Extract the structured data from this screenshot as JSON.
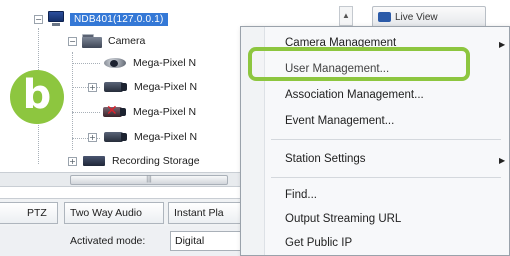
{
  "tree": {
    "server_label": "NDB401(127.0.0.1)",
    "camera_folder": "Camera",
    "cameras": [
      {
        "label": "Mega-Pixel N",
        "icon": "dome-camera-icon"
      },
      {
        "label": "Mega-Pixel N",
        "icon": "box-camera-icon"
      },
      {
        "label": "Mega-Pixel N",
        "icon": "disconnected-camera-icon"
      },
      {
        "label": "Mega-Pixel N",
        "icon": "box-camera-icon"
      }
    ],
    "storage_label": "Recording Storage",
    "live_view_label": "Live View"
  },
  "scrollbar": {
    "thumb_grip": "|||"
  },
  "tabs": [
    "PTZ",
    "Two Way Audio",
    "Instant Pla"
  ],
  "mode": {
    "label": "Activated mode:",
    "value": "Digital"
  },
  "badge": {
    "letter": "b",
    "color": "#8dc63f"
  },
  "context_menu": {
    "items": [
      {
        "label": "Camera Management",
        "submenu": true
      },
      {
        "label": "User Management...",
        "submenu": false,
        "highlighted": true
      },
      {
        "label": "Association Management...",
        "submenu": false
      },
      {
        "label": "Event Management...",
        "submenu": false
      },
      {
        "label": "Station Settings",
        "submenu": true
      },
      {
        "label": "Find...",
        "submenu": false
      },
      {
        "label": "Output Streaming URL",
        "submenu": false
      },
      {
        "label": "Get Public IP",
        "submenu": false
      }
    ],
    "highlight_color": "#8dc63f"
  }
}
